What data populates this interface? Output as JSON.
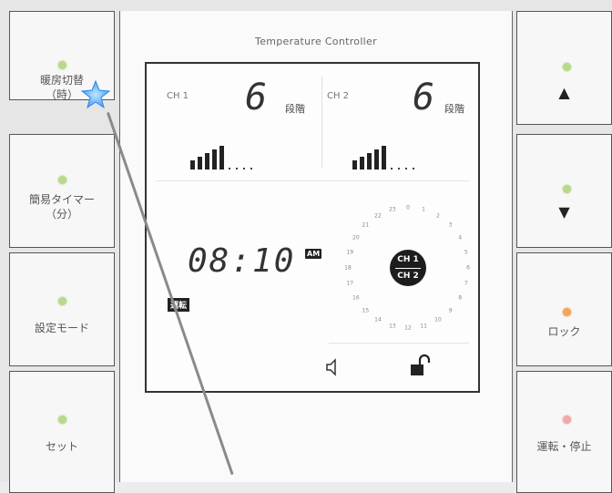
{
  "panel": {
    "title": "Temperature Controller"
  },
  "left_buttons": [
    {
      "label": "暖房切替\n（時）",
      "led": "green"
    },
    {
      "label": "簡易タイマー\n（分）",
      "led": "green"
    },
    {
      "label": "設定モード",
      "led": "green"
    },
    {
      "label": "セット",
      "led": "green"
    }
  ],
  "right_buttons": [
    {
      "label": "",
      "icon": "up-triangle-icon",
      "glyph": "▲",
      "led": "green"
    },
    {
      "label": "",
      "icon": "down-triangle-icon",
      "glyph": "▼",
      "led": "green"
    },
    {
      "label": "ロック",
      "led": "orange"
    },
    {
      "label": "運転・停止",
      "led": "pink"
    }
  ],
  "display": {
    "ch1": {
      "label": "CH 1",
      "level": "6",
      "unit": "段階",
      "bars_on": 5,
      "bars_total": 9
    },
    "ch2": {
      "label": "CH 2",
      "level": "6",
      "unit": "段階",
      "bars_on": 5,
      "bars_total": 9
    },
    "clock": "08:10",
    "ampm": "AM",
    "mode_badge": "運転",
    "dial_badge_top": "CH 1",
    "dial_badge_bottom": "CH 2",
    "dial_numbers": [
      "0",
      "1",
      "2",
      "3",
      "4",
      "5",
      "6",
      "7",
      "8",
      "9",
      "10",
      "11",
      "12",
      "13",
      "14",
      "15",
      "16",
      "17",
      "18",
      "19",
      "20",
      "21",
      "22",
      "23"
    ]
  },
  "colors": {
    "led_green": "#b8d98a",
    "led_orange": "#f3a35c",
    "led_pink": "#f0a8aa",
    "cursor": "#4aa3ff"
  }
}
